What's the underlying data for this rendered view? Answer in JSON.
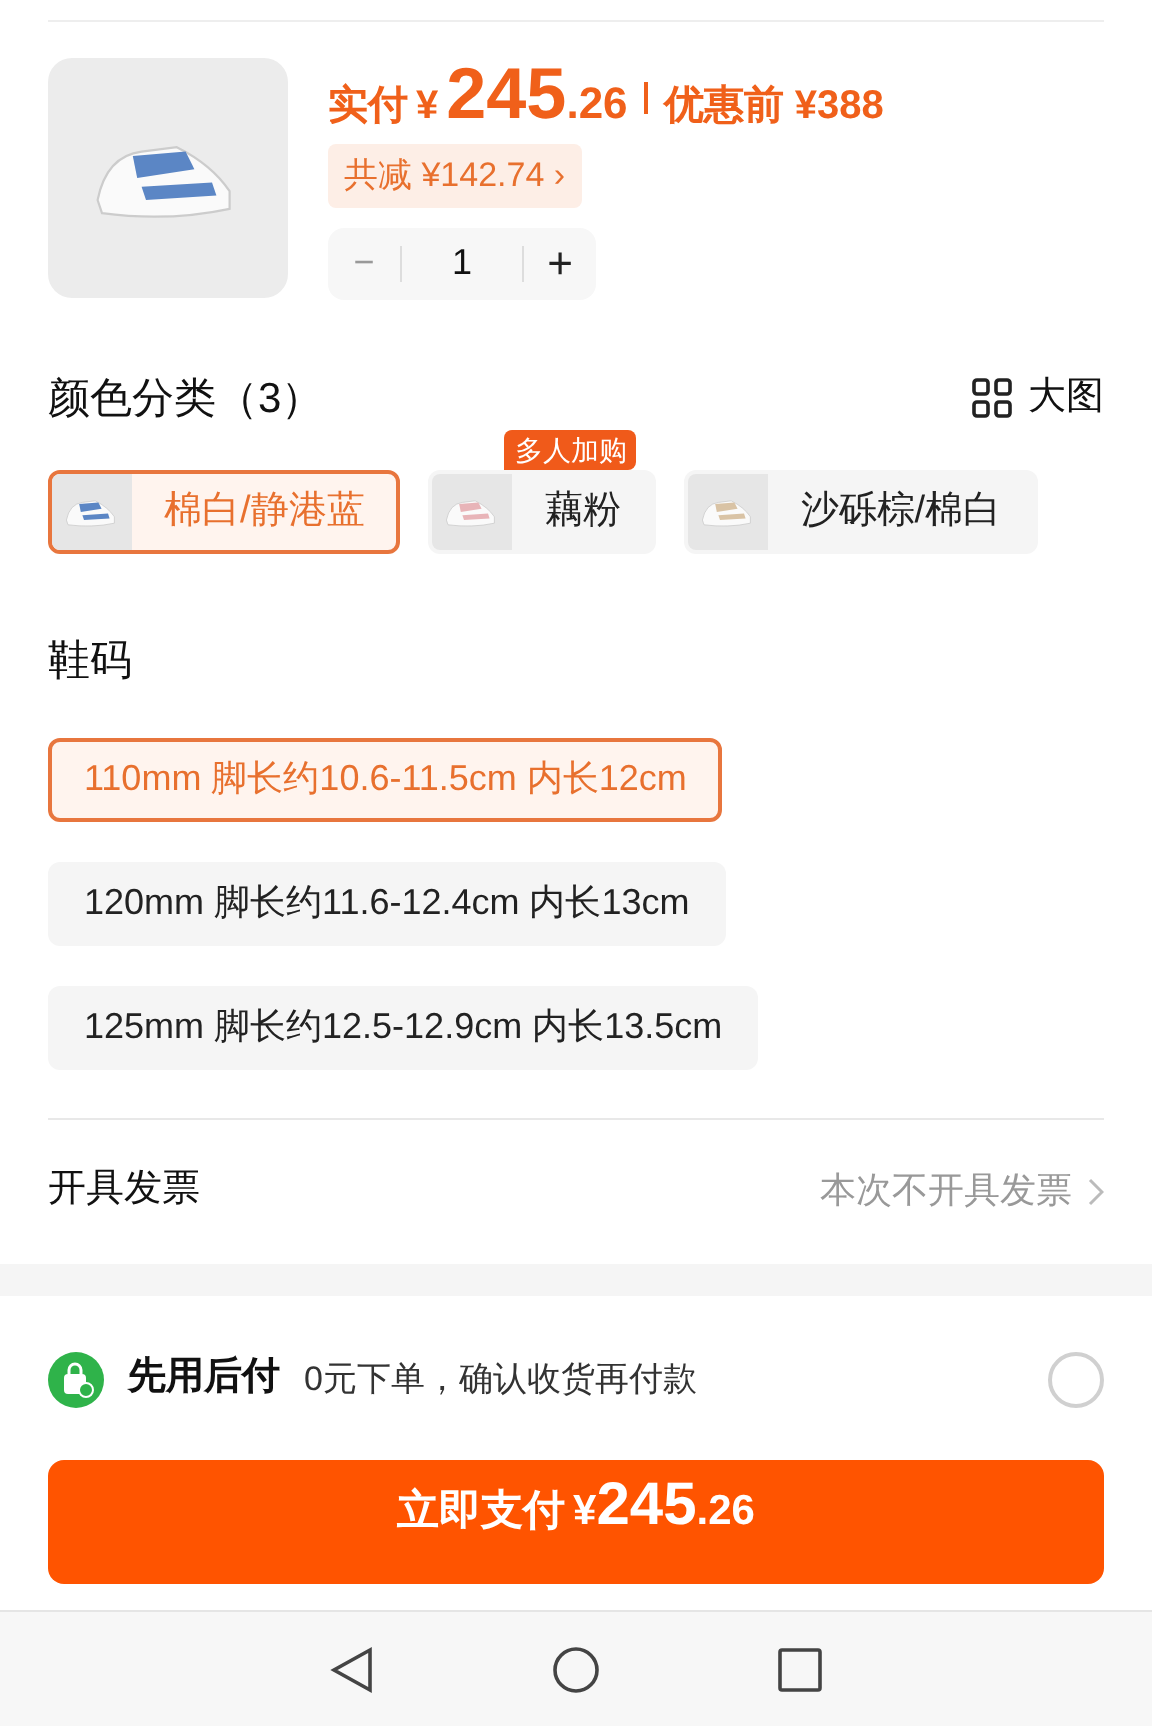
{
  "product": {
    "price_label": "实付",
    "currency": "¥",
    "price_integer": "245",
    "price_decimal": ".26",
    "original_price": "优惠前 ¥388",
    "discount": "共减 ¥142.74",
    "discount_arrow": "›",
    "quantity": "1",
    "minus_disabled": true,
    "minus": "−",
    "plus": "+"
  },
  "colors": {
    "title": "颜色分类（3）",
    "big_image": "大图",
    "options": [
      {
        "label": "棉白/静港蓝",
        "selected": true
      },
      {
        "label": "藕粉",
        "selected": false,
        "badge": "多人加购"
      },
      {
        "label": "沙砾棕/棉白",
        "selected": false
      }
    ]
  },
  "sizes": {
    "title": "鞋码",
    "options": [
      {
        "label": "110mm 脚长约10.6-11.5cm 内长12cm",
        "selected": true
      },
      {
        "label": "120mm 脚长约11.6-12.4cm 内长13cm",
        "selected": false
      },
      {
        "label": "125mm 脚长约12.5-12.9cm 内长13.5cm",
        "selected": false
      }
    ]
  },
  "invoice": {
    "label": "开具发票",
    "value": "本次不开具发票"
  },
  "pay_later": {
    "title": "先用后付",
    "description": "0元下单，确认收货再付款",
    "selected": false
  },
  "pay_button": {
    "label": "立即支付",
    "currency": "¥",
    "integer": "245",
    "decimal": ".26"
  }
}
